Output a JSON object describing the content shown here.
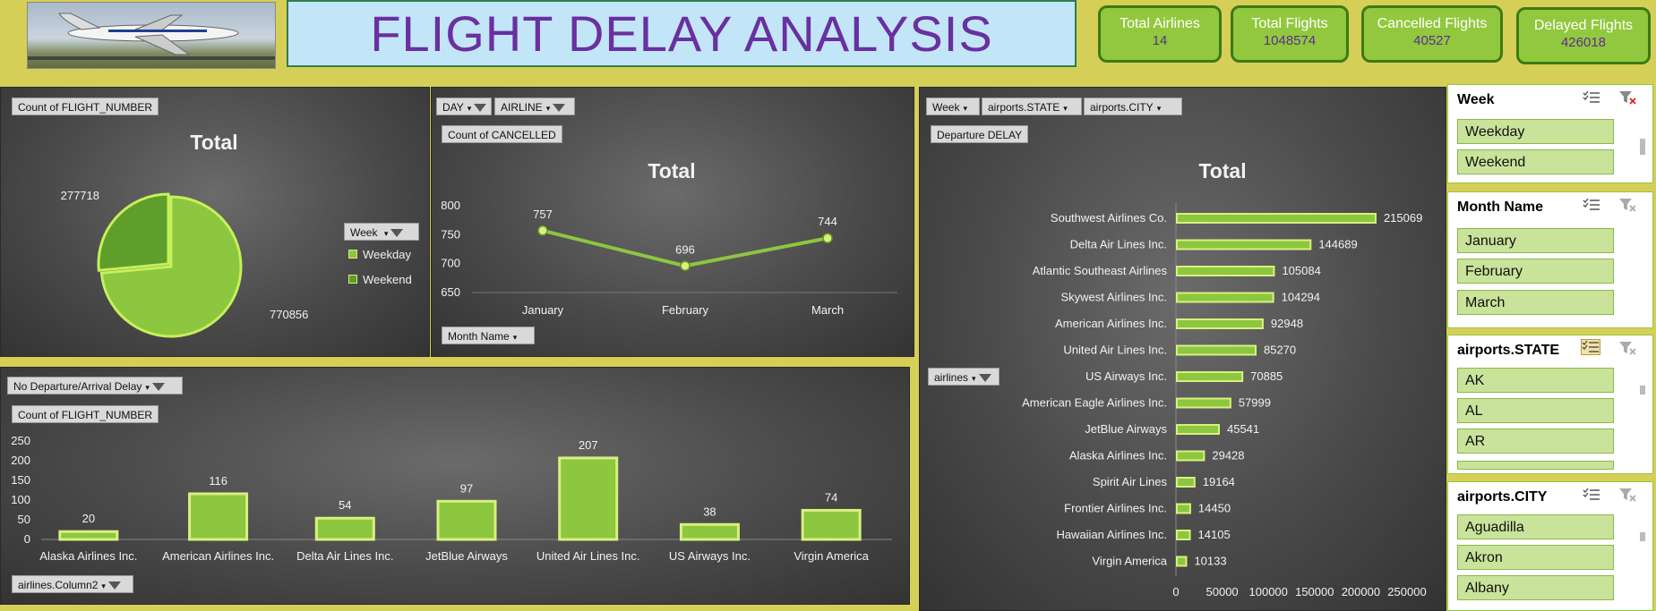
{
  "header": {
    "title": "FLIGHT DELAY ANALYSIS"
  },
  "kpis": [
    {
      "label": "Total Airlines",
      "value": "14"
    },
    {
      "label": "Total Flights",
      "value": "1048574"
    },
    {
      "label": "Cancelled Flights",
      "value": "40527"
    },
    {
      "label": "Delayed Flights",
      "value": "426018"
    }
  ],
  "pie_panel": {
    "field_button": "Count  of FLIGHT_NUMBER",
    "legend_button": "Week"
  },
  "line_panel": {
    "filter1": "DAY",
    "filter2": "AIRLINE",
    "field_button": "Count  of CANCELLED",
    "axis_button": "Month  Name"
  },
  "hbar_panel": {
    "filter1": "Week",
    "filter2": "airports.STATE",
    "filter3": "airports.CITY",
    "field_button": "Departure  DELAY",
    "axis_button": "airlines"
  },
  "vbar_panel": {
    "filter1": "No  Departure/Arrival  Delay",
    "field_button": "Count  of FLIGHT_NUMBER",
    "axis_button": "airlines.Column2"
  },
  "chart_data": [
    {
      "type": "pie",
      "title": "Total",
      "categories": [
        "Weekday",
        "Weekend"
      ],
      "values": [
        770856,
        277718
      ],
      "legend": "right",
      "colors": [
        "#8dc63f",
        "#5f9e2b"
      ]
    },
    {
      "type": "line",
      "title": "Total",
      "categories": [
        "January",
        "February",
        "March"
      ],
      "values": [
        757,
        696,
        744
      ],
      "ylim": [
        650,
        800
      ],
      "yticks": [
        650,
        700,
        750,
        800
      ],
      "color": "#8dc63f"
    },
    {
      "type": "bar",
      "orientation": "horizontal",
      "title": "Total",
      "categories": [
        "Southwest Airlines Co.",
        "Delta Air Lines Inc.",
        "Atlantic Southeast Airlines",
        "Skywest Airlines Inc.",
        "American Airlines Inc.",
        "United Air Lines Inc.",
        "US Airways Inc.",
        "American Eagle Airlines Inc.",
        "JetBlue Airways",
        "Alaska Airlines Inc.",
        "Spirit Air Lines",
        "Frontier Airlines Inc.",
        "Hawaiian Airlines Inc.",
        "Virgin America"
      ],
      "values": [
        215069,
        144689,
        105084,
        104294,
        92948,
        85270,
        70885,
        57999,
        45541,
        29428,
        19164,
        14450,
        14105,
        10133
      ],
      "xlim": [
        0,
        250000
      ],
      "xticks": [
        0,
        50000,
        100000,
        150000,
        200000,
        250000
      ],
      "color": "#8dc63f"
    },
    {
      "type": "bar",
      "orientation": "vertical",
      "categories": [
        "Alaska Airlines Inc.",
        "American Airlines Inc.",
        "Delta Air Lines Inc.",
        "JetBlue Airways",
        "United Air Lines Inc.",
        "US Airways Inc.",
        "Virgin America"
      ],
      "values": [
        20,
        116,
        54,
        97,
        207,
        38,
        74
      ],
      "ylim": [
        0,
        250
      ],
      "yticks": [
        0,
        50,
        100,
        150,
        200,
        250
      ],
      "color": "#8dc63f"
    }
  ],
  "slicers": [
    {
      "header": "Week",
      "items": [
        "Weekday",
        "Weekend"
      ]
    },
    {
      "header": "Month Name",
      "items": [
        "January",
        "February",
        "March"
      ]
    },
    {
      "header": "airports.STATE",
      "items": [
        "AK",
        "AL",
        "AR"
      ]
    },
    {
      "header": "airports.CITY",
      "items": [
        "Aguadilla",
        "Akron",
        "Albany"
      ]
    }
  ]
}
